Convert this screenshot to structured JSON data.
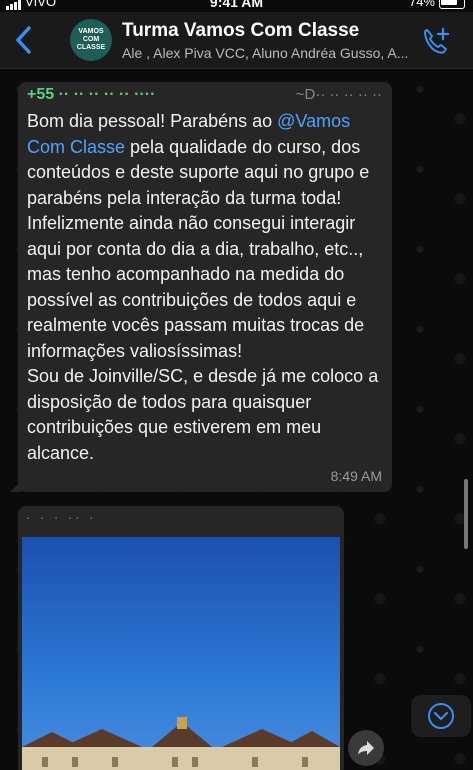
{
  "status": {
    "carrier": "VIVO",
    "time": "9:41 AM",
    "battery": "74%"
  },
  "header": {
    "title": "Turma Vamos Com Classe",
    "subtitle": "Ale , Alex Piva VCC, Aluno Andréa Gusso, A...",
    "avatar_lines": [
      "VAMOS",
      "COM",
      "CLASSE"
    ]
  },
  "message": {
    "sender_phone": "+55 ·· ·· ·· ·· ·· ····",
    "sender_name": "~D·· ·· ·· ·· ··",
    "text_before_mention": "Bom dia pessoal! Parabéns ao ",
    "mention": "@Vamos Com Classe",
    "text_after_mention": " pela qualidade do curso, dos conteúdos e deste suporte aqui no grupo e parabéns pela interação da turma toda! Infelizmente ainda não consegui interagir aqui por conta do dia a dia, trabalho, etc.., mas tenho acompanhado na medida do possível as contribuições de todos aqui e realmente vocês passam muitas trocas de informações valiosíssimas!",
    "text_second": "Sou de Joinville/SC, e desde já me coloco a disposição de todos para quaisquer contribuições que estiverem em meu alcance.",
    "time": "8:49 AM"
  },
  "image_message": {
    "sender": "· ·  · ··  ·"
  }
}
